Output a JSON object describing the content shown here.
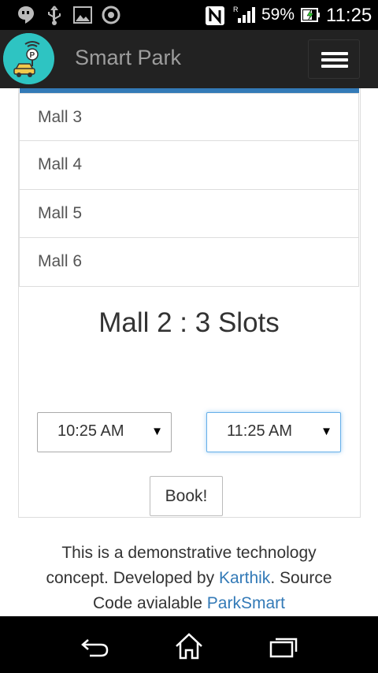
{
  "status_bar": {
    "battery_percent": "59%",
    "clock": "11:25",
    "icons": [
      "hangouts-icon",
      "usb-icon",
      "gallery-icon",
      "chrome-icon",
      "nfc-icon",
      "signal-icon",
      "battery-charging-icon"
    ]
  },
  "app_bar": {
    "title": "Smart Park",
    "logo_icon": "parking-car-logo-icon",
    "menu_icon": "hamburger-menu-icon"
  },
  "mall_list": {
    "items": [
      "Mall 3",
      "Mall 4",
      "Mall 5",
      "Mall 6"
    ]
  },
  "slots": {
    "heading": "Mall 2 : 3 Slots"
  },
  "booking": {
    "start_time": "10:25 AM",
    "end_time": "11:25 AM",
    "book_label": "Book!"
  },
  "footer": {
    "line1": "This is a demonstrative technology",
    "line2_prefix": "concept. Developed by ",
    "author_link": "Karthik",
    "line2_suffix": ". Source",
    "line3_prefix": "Code avialable ",
    "repo_link": "ParkSmart"
  },
  "nav_bar": {
    "icons": [
      "back-icon",
      "home-icon",
      "recent-apps-icon"
    ]
  },
  "colors": {
    "accent": "#337ab7",
    "app_bar": "#222222",
    "logo_bg": "#2ec4c2"
  }
}
